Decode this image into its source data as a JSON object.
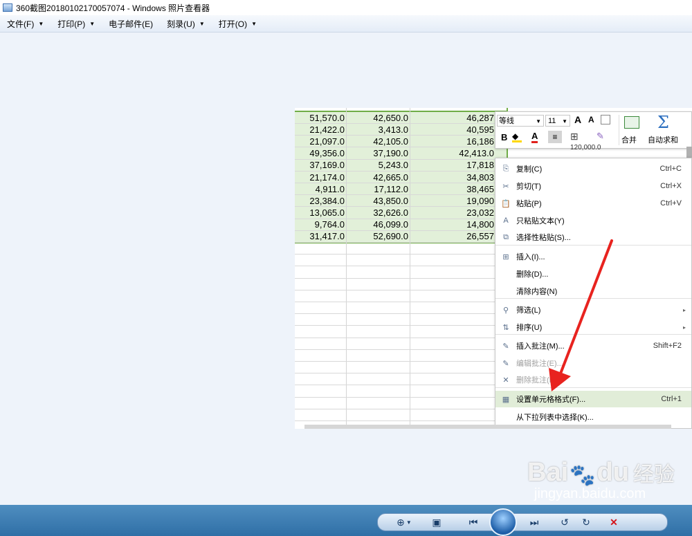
{
  "window": {
    "title": "360截图20180102170057074 - Windows 照片查看器"
  },
  "menu": [
    {
      "label": "文件(F)",
      "dropdown": true
    },
    {
      "label": "打印(P)",
      "dropdown": true
    },
    {
      "label": "电子邮件(E)",
      "dropdown": false
    },
    {
      "label": "刻录(U)",
      "dropdown": true
    },
    {
      "label": "打开(O)",
      "dropdown": true
    }
  ],
  "sheet": {
    "columns": [
      [
        "51,570.0",
        "21,422.0",
        "21,097.0",
        "49,356.0",
        "37,169.0",
        "21,174.0",
        "4,911.0",
        "23,384.0",
        "13,065.0",
        "9,764.0",
        "31,417.0"
      ],
      [
        "42,650.0",
        "3,413.0",
        "42,105.0",
        "37,190.0",
        "5,243.0",
        "42,665.0",
        "17,112.0",
        "43,850.0",
        "32,626.0",
        "46,099.0",
        "52,690.0"
      ],
      [
        "46,287",
        "40,595",
        "16,186",
        "42,413.0",
        "17,818",
        "34,803",
        "38,465",
        "19,090",
        "23,032",
        "14,800",
        "26,557"
      ]
    ],
    "side_value": "120,000.0"
  },
  "mini_toolbar": {
    "font_name": "等线",
    "font_size": "11",
    "bold": "B",
    "font_color": "A",
    "grow_font": "A",
    "shrink_font": "A",
    "merge_label": "合并",
    "autosum_label": "自动求和"
  },
  "context_menu": [
    {
      "label": "复制(C)",
      "shortcut": "Ctrl+C",
      "icon": "copy-icon"
    },
    {
      "label": "剪切(T)",
      "shortcut": "Ctrl+X",
      "icon": "scissors-icon"
    },
    {
      "label": "粘贴(P)",
      "shortcut": "Ctrl+V",
      "icon": "paste-icon"
    },
    {
      "label": "只粘贴文本(Y)",
      "shortcut": "",
      "icon": "paste-text-icon"
    },
    {
      "label": "选择性粘贴(S)...",
      "shortcut": "",
      "icon": "paste-special-icon"
    },
    {
      "label": "插入(I)...",
      "shortcut": "",
      "icon": "insert-icon"
    },
    {
      "label": "删除(D)...",
      "shortcut": "",
      "icon": ""
    },
    {
      "label": "清除内容(N)",
      "shortcut": "",
      "icon": ""
    },
    {
      "label": "筛选(L)",
      "shortcut": "",
      "icon": "filter-icon",
      "submenu": true
    },
    {
      "label": "排序(U)",
      "shortcut": "",
      "icon": "sort-icon",
      "submenu": true
    },
    {
      "label": "插入批注(M)...",
      "shortcut": "Shift+F2",
      "icon": "comment-icon"
    },
    {
      "label": "编辑批注(E)...",
      "shortcut": "",
      "icon": "edit-comment-icon",
      "disabled": true
    },
    {
      "label": "删除批注(M)",
      "shortcut": "",
      "icon": "delete-comment-icon",
      "disabled": true
    },
    {
      "label": "设置单元格格式(F)...",
      "shortcut": "Ctrl+1",
      "icon": "format-cells-icon",
      "highlighted": true
    },
    {
      "label": "从下拉列表中选择(K)...",
      "shortcut": "",
      "icon": ""
    }
  ],
  "annotation": {
    "arrow_color": "#e8231f"
  },
  "watermark": {
    "brand": "Bai",
    "brand2": "du",
    "cn": "经验",
    "url": "jingyan.baidu.com"
  },
  "colors": {
    "selection_fill": "#e2f0d9",
    "selection_border": "#70ad47",
    "highlight": "#e1edd8",
    "taskbar": "#3a7ab3"
  }
}
